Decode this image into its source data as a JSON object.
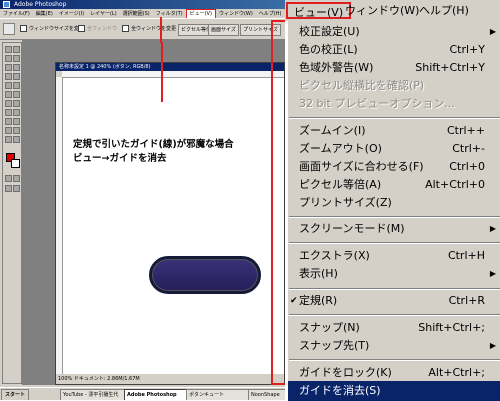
{
  "photoshop": {
    "title": "Adobe Photoshop",
    "menus": [
      "ファイル(F)",
      "編集(E)",
      "イメージ(I)",
      "レイヤー(L)",
      "選択範囲(S)",
      "フィルタ(T)",
      "ビュー(V)",
      "ウィンドウ(W)",
      "ヘルプ(H)"
    ],
    "options": {
      "check1": "ウィンドウサイズを変更",
      "check2": "全ウィンドウ",
      "check3": "全ウィンドウを変更",
      "btn1": "ピクセル等倍",
      "btn2": "画面サイズ",
      "btn3": "プリントサイズ"
    },
    "document_title": "名称未設定 1 @ 240% (ボタン, RGB/8)",
    "status": "100%  ドキュメント: 2.86M/1.67M",
    "annotation_line1": "定規で引いたガイド(線)が邪魔な場合",
    "annotation_line2": "ビュー→ガイドを消去",
    "foreground_color": "#e00000",
    "background_color": "#ffffff"
  },
  "taskbar": {
    "start": "スタート",
    "tasks": [
      "YouTube - 漂平引播生代",
      "Adobe Photoshop",
      "ポタンキュート",
      "NoonShape"
    ]
  },
  "menubar": {
    "view": "ビュー(V)",
    "window": "ウィンドウ(W)",
    "help": "ヘルプ(H)"
  },
  "view_menu": {
    "proof_setup": "校正設定(U)",
    "proof_colors": "色の校正(L)",
    "proof_colors_sc": "Ctrl+Y",
    "gamut_warning": "色域外警告(W)",
    "gamut_warning_sc": "Shift+Ctrl+Y",
    "pixel_aspect": "ピクセル縦横比を確認(P)",
    "preview_32bit": "32 bit プレビューオプション...",
    "zoom_in": "ズームイン(I)",
    "zoom_in_sc": "Ctrl++",
    "zoom_out": "ズームアウト(O)",
    "zoom_out_sc": "Ctrl+-",
    "fit_screen": "画面サイズに合わせる(F)",
    "fit_screen_sc": "Ctrl+0",
    "actual_pixels": "ピクセル等倍(A)",
    "actual_pixels_sc": "Alt+Ctrl+0",
    "print_size": "プリントサイズ(Z)",
    "screen_mode": "スクリーンモード(M)",
    "extras": "エクストラ(X)",
    "extras_sc": "Ctrl+H",
    "show": "表示(H)",
    "rulers": "定規(R)",
    "rulers_sc": "Ctrl+R",
    "snap": "スナップ(N)",
    "snap_sc": "Shift+Ctrl+;",
    "snap_to": "スナップ先(T)",
    "lock_guides": "ガイドをロック(K)",
    "lock_guides_sc": "Alt+Ctrl+;",
    "clear_guides": "ガイドを消去(S)"
  }
}
